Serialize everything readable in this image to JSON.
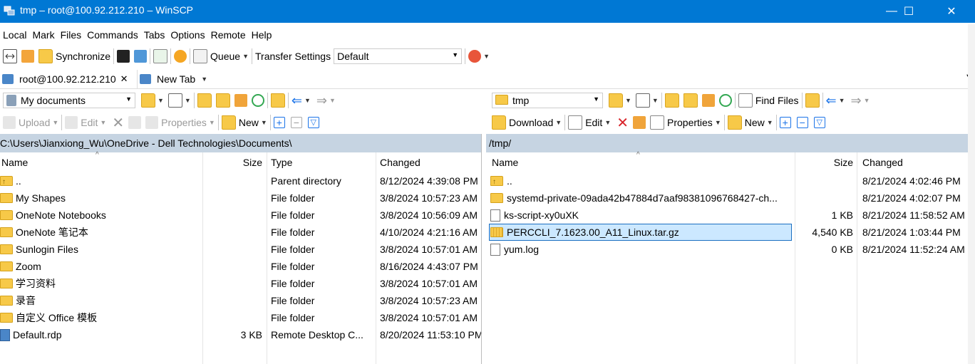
{
  "window": {
    "title": "tmp – root@100.92.212.210 – WinSCP",
    "minimize": "—",
    "maximize": "☐",
    "close": "✕"
  },
  "menu": [
    "Local",
    "Mark",
    "Files",
    "Commands",
    "Tabs",
    "Options",
    "Remote",
    "Help"
  ],
  "toolbar": {
    "synchronize": "Synchronize",
    "queue": "Queue",
    "transfer_settings_label": "Transfer Settings",
    "transfer_settings_value": "Default"
  },
  "tabs": [
    {
      "label": "root@100.92.212.210",
      "close": "✕"
    },
    {
      "label": "New Tab"
    }
  ],
  "left": {
    "location": "My documents",
    "upload": "Upload",
    "edit": "Edit",
    "properties": "Properties",
    "new": "New",
    "path": "C:\\Users\\Jianxiong_Wu\\OneDrive - Dell Technologies\\Documents\\",
    "columns": [
      "Name",
      "Size",
      "Type",
      "Changed"
    ],
    "rows": [
      {
        "name": "..",
        "size": "",
        "type": "Parent directory",
        "changed": "8/12/2024 4:39:08 PM",
        "icon": "parent-folder-icon"
      },
      {
        "name": "My Shapes",
        "size": "",
        "type": "File folder",
        "changed": "3/8/2024 10:57:23 AM",
        "icon": "folder-icon"
      },
      {
        "name": "OneNote Notebooks",
        "size": "",
        "type": "File folder",
        "changed": "3/8/2024 10:56:09 AM",
        "icon": "folder-icon"
      },
      {
        "name": "OneNote 笔记本",
        "size": "",
        "type": "File folder",
        "changed": "4/10/2024 4:21:16 AM",
        "icon": "folder-icon"
      },
      {
        "name": "Sunlogin Files",
        "size": "",
        "type": "File folder",
        "changed": "3/8/2024 10:57:01 AM",
        "icon": "folder-icon"
      },
      {
        "name": "Zoom",
        "size": "",
        "type": "File folder",
        "changed": "8/16/2024 4:43:07 PM",
        "icon": "folder-icon"
      },
      {
        "name": "学习资料",
        "size": "",
        "type": "File folder",
        "changed": "3/8/2024 10:57:01 AM",
        "icon": "folder-icon"
      },
      {
        "name": "录音",
        "size": "",
        "type": "File folder",
        "changed": "3/8/2024 10:57:23 AM",
        "icon": "folder-icon"
      },
      {
        "name": "自定义 Office 模板",
        "size": "",
        "type": "File folder",
        "changed": "3/8/2024 10:57:01 AM",
        "icon": "folder-icon"
      },
      {
        "name": "Default.rdp",
        "size": "3 KB",
        "type": "Remote Desktop C...",
        "changed": "8/20/2024 11:53:10 PM",
        "icon": "rdp-file-icon"
      }
    ]
  },
  "right": {
    "location": "tmp",
    "find_files": "Find Files",
    "download": "Download",
    "edit": "Edit",
    "properties": "Properties",
    "new": "New",
    "path": "/tmp/",
    "columns": [
      "Name",
      "Size",
      "Changed"
    ],
    "rows": [
      {
        "name": "..",
        "size": "",
        "changed": "8/21/2024 4:02:46 PM",
        "icon": "parent-folder-icon"
      },
      {
        "name": "systemd-private-09ada42b47884d7aaf98381096768427-ch...",
        "size": "",
        "changed": "8/21/2024 4:02:07 PM",
        "icon": "folder-icon"
      },
      {
        "name": "ks-script-xy0uXK",
        "size": "1 KB",
        "changed": "8/21/2024 11:58:52 AM",
        "icon": "file-icon"
      },
      {
        "name": "PERCCLI_7.1623.00_A11_Linux.tar.gz",
        "size": "4,540 KB",
        "changed": "8/21/2024 1:03:44 PM",
        "icon": "archive-icon",
        "selected": true
      },
      {
        "name": "yum.log",
        "size": "0 KB",
        "changed": "8/21/2024 11:52:24 AM",
        "icon": "file-icon"
      }
    ]
  },
  "colors": {
    "titlebar": "#0078d4",
    "pathbar": "#c6d4e2",
    "selection": "#cce8ff"
  }
}
